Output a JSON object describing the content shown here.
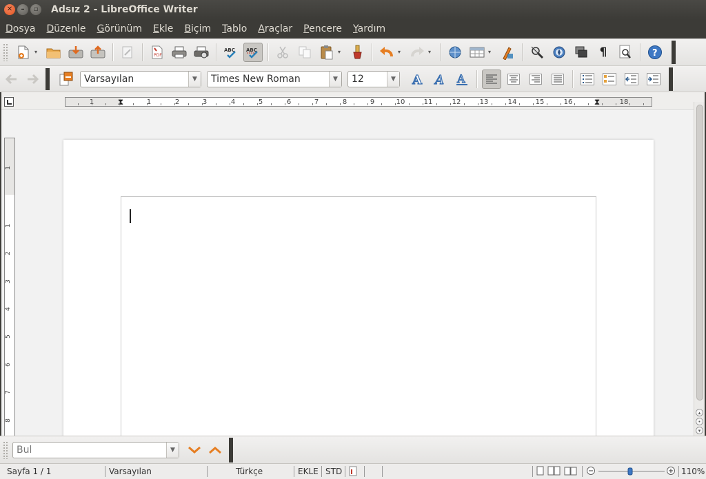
{
  "window": {
    "title": "Adsız 2 - LibreOffice Writer"
  },
  "menu": [
    {
      "label": "Dosya",
      "accel": "D",
      "rest": "osya"
    },
    {
      "label": "Düzenle",
      "accel": "D",
      "rest": "üzenle"
    },
    {
      "label": "Görünüm",
      "accel": "G",
      "rest": "örünüm"
    },
    {
      "label": "Ekle",
      "accel": "E",
      "rest": "kle"
    },
    {
      "label": "Biçim",
      "accel": "B",
      "rest": "içim"
    },
    {
      "label": "Tablo",
      "accel": "T",
      "rest": "ablo"
    },
    {
      "label": "Araçlar",
      "accel": "A",
      "rest": "raçlar"
    },
    {
      "label": "Pencere",
      "accel": "P",
      "rest": "encere"
    },
    {
      "label": "Yardım",
      "accel": "Y",
      "rest": "ardım"
    }
  ],
  "formatting": {
    "paragraph_style": "Varsayılan",
    "font_name": "Times New Roman",
    "font_size": "12"
  },
  "ruler": {
    "labels": [
      "1",
      "1",
      "2",
      "3",
      "4",
      "5",
      "6",
      "7",
      "8",
      "9",
      "10",
      "11",
      "12",
      "13",
      "14",
      "15",
      "16",
      "18"
    ],
    "vlabels": [
      "1",
      "1",
      "2",
      "3",
      "4",
      "5",
      "6",
      "7",
      "8"
    ]
  },
  "find": {
    "placeholder": "Bul"
  },
  "status": {
    "page": "Sayfa 1 / 1",
    "style": "Varsayılan",
    "language": "Türkçe",
    "insert_mode": "EKLE",
    "selection_mode": "STD",
    "zoom": "110%"
  },
  "colors": {
    "accent": "#e05420",
    "toolbar_bg": "#edeceb",
    "titlebar_bg": "#3c3b37"
  }
}
